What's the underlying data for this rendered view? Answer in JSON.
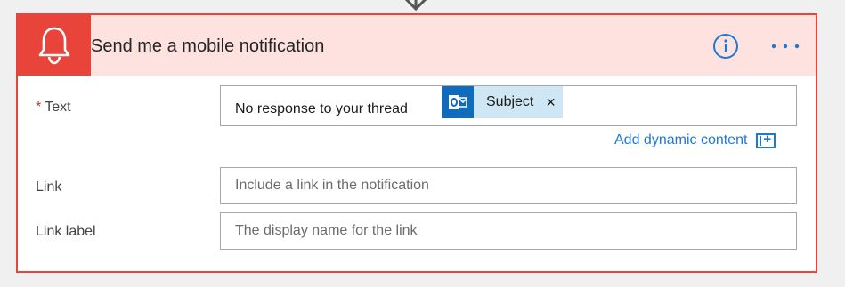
{
  "header": {
    "title": "Send me a mobile notification",
    "icon": "bell-icon",
    "accent_color": "#e8443a",
    "header_bg": "#fde2e0"
  },
  "fields": {
    "text": {
      "label": "Text",
      "required_marker": "*",
      "value_text": "No response to your thread",
      "token": {
        "icon": "outlook-icon",
        "label": "Subject",
        "remove_glyph": "×"
      }
    },
    "dynamic_content": {
      "label": "Add dynamic content"
    },
    "link": {
      "label": "Link",
      "placeholder": "Include a link in the notification"
    },
    "link_label": {
      "label": "Link label",
      "placeholder": "The display name for the link"
    }
  },
  "actions": {
    "info_icon": "info-icon",
    "more_icon": "more-options-icon",
    "link_color": "#1f78d1"
  }
}
